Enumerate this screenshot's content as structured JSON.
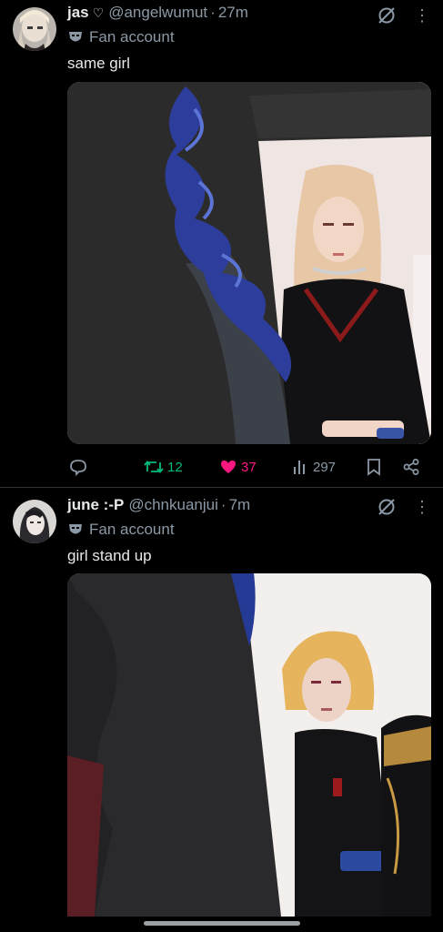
{
  "tweets": [
    {
      "display_name": "jas",
      "name_emoji": "♡",
      "handle": "@angelwumut",
      "time": "27m",
      "badge_label": "Fan account",
      "text": "same girl",
      "actions": {
        "retweets": "12",
        "likes": "37",
        "views": "297"
      }
    },
    {
      "display_name": "june :-P",
      "handle": "@chnkuanjui",
      "time": "7m",
      "badge_label": "Fan account",
      "text": "girl stand up"
    }
  ],
  "separator": "·",
  "colors": {
    "background": "#000000",
    "text": "#e7e9ea",
    "muted": "#8b98a5",
    "retweet": "#00ba7c",
    "like": "#f91880"
  }
}
